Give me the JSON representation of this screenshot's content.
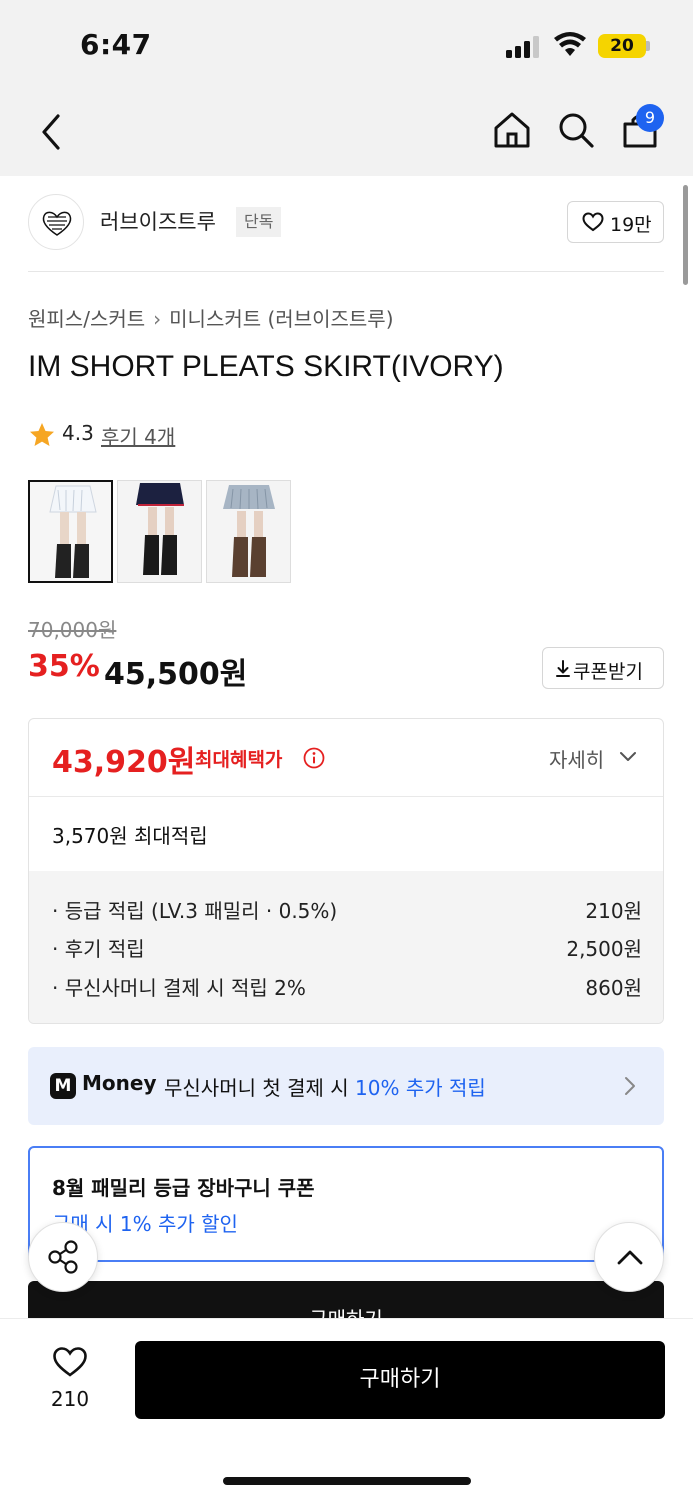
{
  "status_bar": {
    "time": "6:47",
    "battery": "20"
  },
  "nav": {
    "cart_count": "9"
  },
  "brand": {
    "name": "러브이즈트루",
    "tag": "단독",
    "likes": "19만"
  },
  "breadcrumb": {
    "category": "원피스/스커트",
    "subcategory": "미니스커트 (러브이즈트루)"
  },
  "product": {
    "title": "IM SHORT PLEATS SKIRT(IVORY)",
    "rating": "4.3",
    "review_link": "후기 4개",
    "original_price": "70,000원",
    "discount_rate": "35%",
    "sale_price": "45,500원",
    "coupon_button": "쿠폰받기"
  },
  "benefit": {
    "best_price": "43,920원",
    "best_label": "최대혜택가",
    "detail_label": "자세히",
    "max_point": "3,570원 최대적립",
    "rows": [
      {
        "label": "· 등급 적립 (LV.3 패밀리 · 0.5%)",
        "value": "210원"
      },
      {
        "label": "· 후기 적립",
        "value": "2,500원"
      },
      {
        "label": "· 무신사머니 결제 시 적립 2%",
        "value": "860원"
      }
    ]
  },
  "money_banner": {
    "logo": "M",
    "brand": "Money",
    "text": "무신사머니 첫 결제 시 ",
    "highlight": "10% 추가 적립"
  },
  "coupon_card": {
    "title": "8월 패밀리 등급 장바구니 쿠폰",
    "subtitle": "구매 시 1% 추가 할인"
  },
  "ghost_buy_label": "구매하기",
  "bottom_bar": {
    "likes": "210",
    "buy_label": "구매하기"
  },
  "colors": {
    "accent_red": "#e52020",
    "accent_blue": "#1e63f0",
    "badge_yellow": "#f5d400",
    "money_bg": "#e9effc"
  },
  "icons": [
    "back-icon",
    "home-icon",
    "search-icon",
    "cart-icon",
    "heart-icon",
    "star-icon",
    "download-icon",
    "info-icon",
    "chevron-down-icon",
    "chevron-right-icon",
    "share-icon",
    "chevron-up-icon"
  ]
}
